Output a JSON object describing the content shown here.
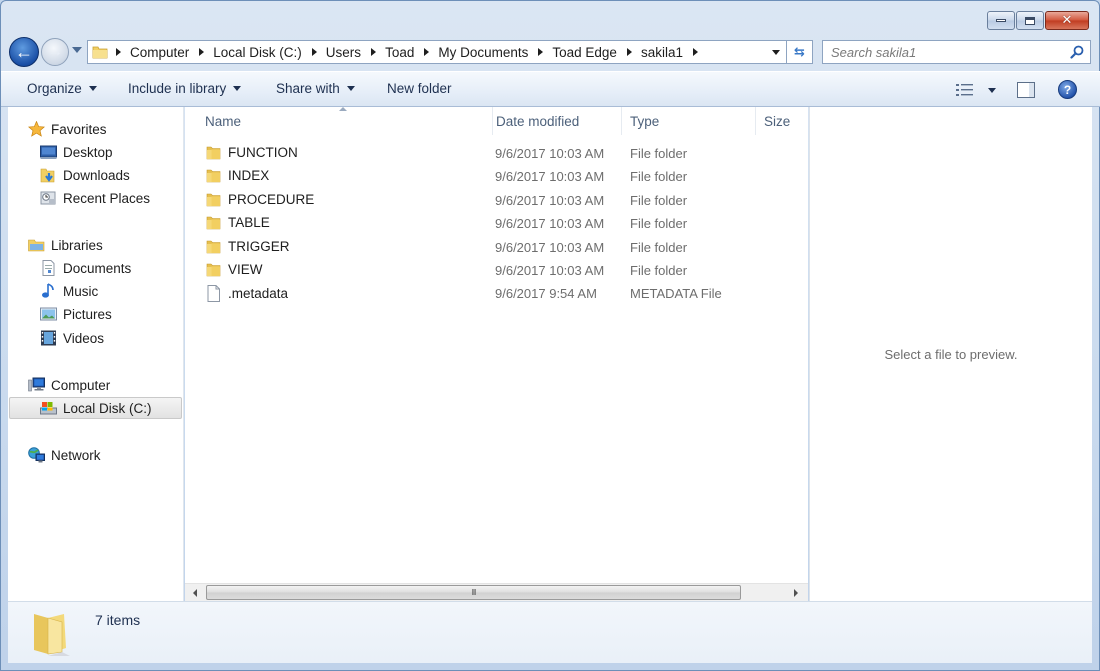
{
  "window": {
    "caption_buttons": [
      {
        "name": "minimize",
        "icon": "minimize-icon"
      },
      {
        "name": "maximize",
        "icon": "maximize-icon"
      },
      {
        "name": "close",
        "icon": "close-icon",
        "glyph": "✕"
      }
    ]
  },
  "nav": {
    "back_glyph": "←",
    "forward_glyph": "→",
    "refresh_glyph": "⇆"
  },
  "address": {
    "breadcrumbs": [
      "Computer",
      "Local Disk (C:)",
      "Users",
      "Toad",
      "My Documents",
      "Toad Edge",
      "sakila1"
    ]
  },
  "search": {
    "placeholder": "Search sakila1",
    "value": ""
  },
  "toolbar": {
    "organize": "Organize",
    "include_in_library": "Include in library",
    "share_with": "Share with",
    "new_folder": "New folder",
    "help_glyph": "?"
  },
  "sidebar": {
    "items": [
      {
        "label": "Favorites",
        "icon": "star-icon",
        "level": 0
      },
      {
        "label": "Desktop",
        "icon": "desktop-icon",
        "level": 1
      },
      {
        "label": "Downloads",
        "icon": "downloads-icon",
        "level": 1
      },
      {
        "label": "Recent Places",
        "icon": "recent-places-icon",
        "level": 1
      },
      {
        "label": "Libraries",
        "icon": "libraries-icon",
        "level": 0
      },
      {
        "label": "Documents",
        "icon": "documents-icon",
        "level": 1
      },
      {
        "label": "Music",
        "icon": "music-icon",
        "level": 1
      },
      {
        "label": "Pictures",
        "icon": "pictures-icon",
        "level": 1
      },
      {
        "label": "Videos",
        "icon": "videos-icon",
        "level": 1
      },
      {
        "label": "Computer",
        "icon": "computer-icon",
        "level": 0
      },
      {
        "label": "Local Disk (C:)",
        "icon": "local-disk-icon",
        "level": 1,
        "selected": true
      },
      {
        "label": "Network",
        "icon": "network-icon",
        "level": 0
      }
    ]
  },
  "file_list": {
    "columns": [
      "Name",
      "Date modified",
      "Type",
      "Size"
    ],
    "sorted_by": "Name",
    "rows": [
      {
        "name": "FUNCTION",
        "date": "9/6/2017 10:03 AM",
        "type": "File folder",
        "size": "",
        "icon": "folder-icon"
      },
      {
        "name": "INDEX",
        "date": "9/6/2017 10:03 AM",
        "type": "File folder",
        "size": "",
        "icon": "folder-icon"
      },
      {
        "name": "PROCEDURE",
        "date": "9/6/2017 10:03 AM",
        "type": "File folder",
        "size": "",
        "icon": "folder-icon"
      },
      {
        "name": "TABLE",
        "date": "9/6/2017 10:03 AM",
        "type": "File folder",
        "size": "",
        "icon": "folder-icon"
      },
      {
        "name": "TRIGGER",
        "date": "9/6/2017 10:03 AM",
        "type": "File folder",
        "size": "",
        "icon": "folder-icon"
      },
      {
        "name": "VIEW",
        "date": "9/6/2017 10:03 AM",
        "type": "File folder",
        "size": "",
        "icon": "folder-icon"
      },
      {
        "name": ".metadata",
        "date": "9/6/2017 9:54 AM",
        "type": "METADATA File",
        "size": "",
        "icon": "file-icon"
      }
    ],
    "scroll_grip": "III"
  },
  "preview": {
    "message": "Select a file to preview."
  },
  "details": {
    "item_count": "7 items"
  },
  "colors": {
    "accent": "#1f4fa8",
    "close_red": "#c8452b",
    "folder_yellow": "#f1cf63"
  }
}
